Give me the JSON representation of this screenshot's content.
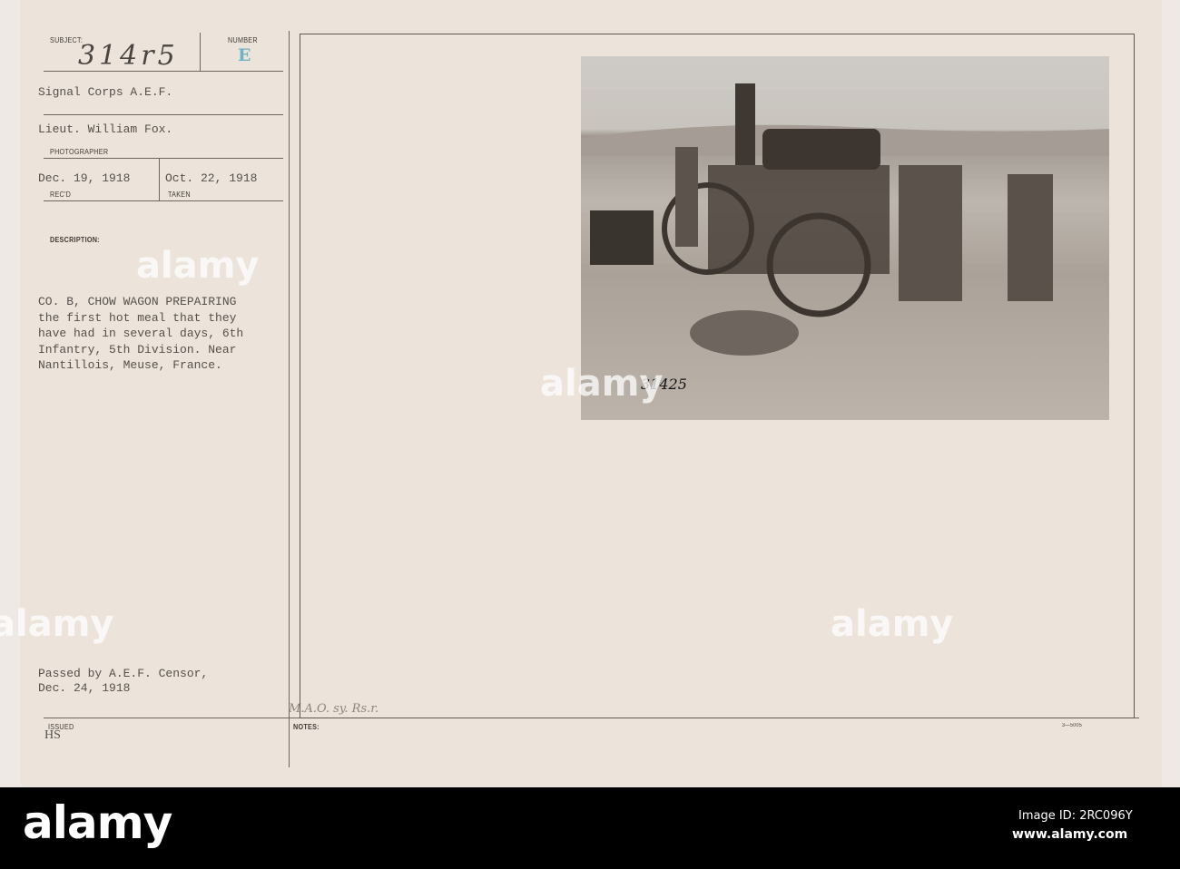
{
  "card": {
    "subject_label": "SUBJECT:",
    "subject_value": "314r5",
    "number_label": "NUMBER",
    "number_value": "E",
    "unit": "Signal Corps A.E.F.",
    "photographer_value": "Lieut. William Fox.",
    "photographer_label": "PHOTOGRAPHER",
    "received_value": "Dec. 19, 1918",
    "received_label": "REC'D",
    "taken_value": "Oct. 22, 1918",
    "taken_label": "TAKEN",
    "description_label": "DESCRIPTION:",
    "description_lines": [
      "CO. B, CHOW WAGON PREPAIRING",
      "the first hot meal that they",
      "have had in several days, 6th",
      "Infantry, 5th Division. Near",
      "Nantillois, Meuse, France."
    ],
    "censor_lines": [
      "Passed by A.E.F. Censor,",
      "Dec. 24, 1918"
    ],
    "issued_label": "ISSUED",
    "issued_value": "HS",
    "notes_label": "NOTES:",
    "notes_handwritten": "M.A.O. sy. Rs.r.",
    "form_number": "3—5005",
    "photo_number": "31425"
  },
  "watermark": {
    "text": "alamy"
  },
  "footer": {
    "logo": "alamy",
    "image_id": "Image ID: 2RC096Y",
    "url": "www.alamy.com"
  },
  "colors": {
    "card": "#ece4da",
    "number_stamp": "#6fb1c6",
    "band": "#000000"
  }
}
